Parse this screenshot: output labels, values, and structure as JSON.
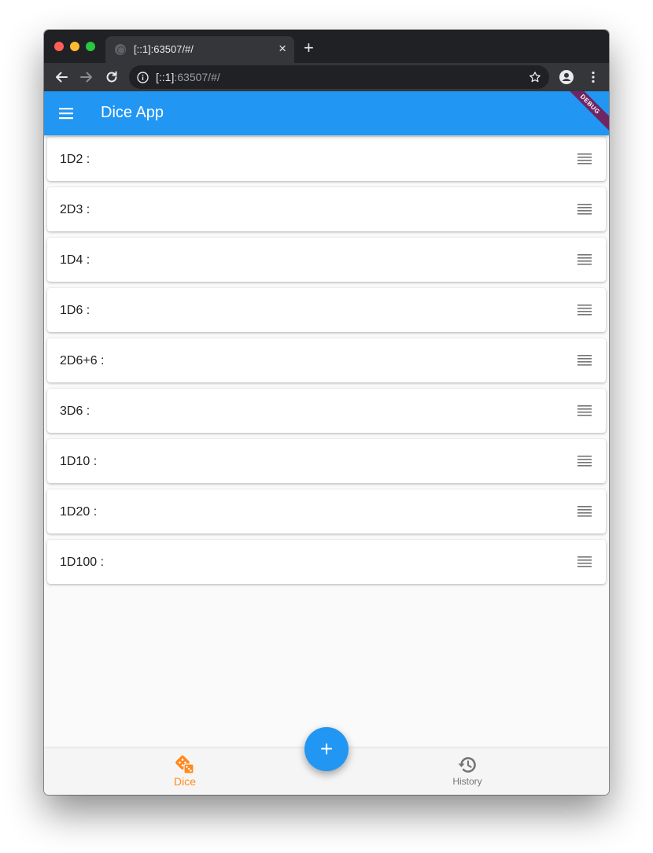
{
  "browser": {
    "tab_title": "[::1]:63507/#/",
    "tab_close": "×",
    "new_tab": "+",
    "url_host": "[::1]",
    "url_rest": ":63507/#/"
  },
  "appbar": {
    "title": "Dice App",
    "debug_label": "DEBUG",
    "color": "#2196f3"
  },
  "dice_list": [
    {
      "label": "1D2 :"
    },
    {
      "label": "2D3 :"
    },
    {
      "label": "1D4 :"
    },
    {
      "label": "1D6 :"
    },
    {
      "label": "2D6+6 :"
    },
    {
      "label": "3D6 :"
    },
    {
      "label": "1D10 :"
    },
    {
      "label": "1D20 :"
    },
    {
      "label": "1D100 :"
    }
  ],
  "fab": {
    "label": "+"
  },
  "bottom_nav": {
    "items": [
      {
        "label": "Dice",
        "icon": "dice-icon",
        "active": true,
        "color": "#ff8a1e"
      },
      {
        "label": "History",
        "icon": "history-icon",
        "active": false,
        "color": "#757575"
      }
    ]
  }
}
